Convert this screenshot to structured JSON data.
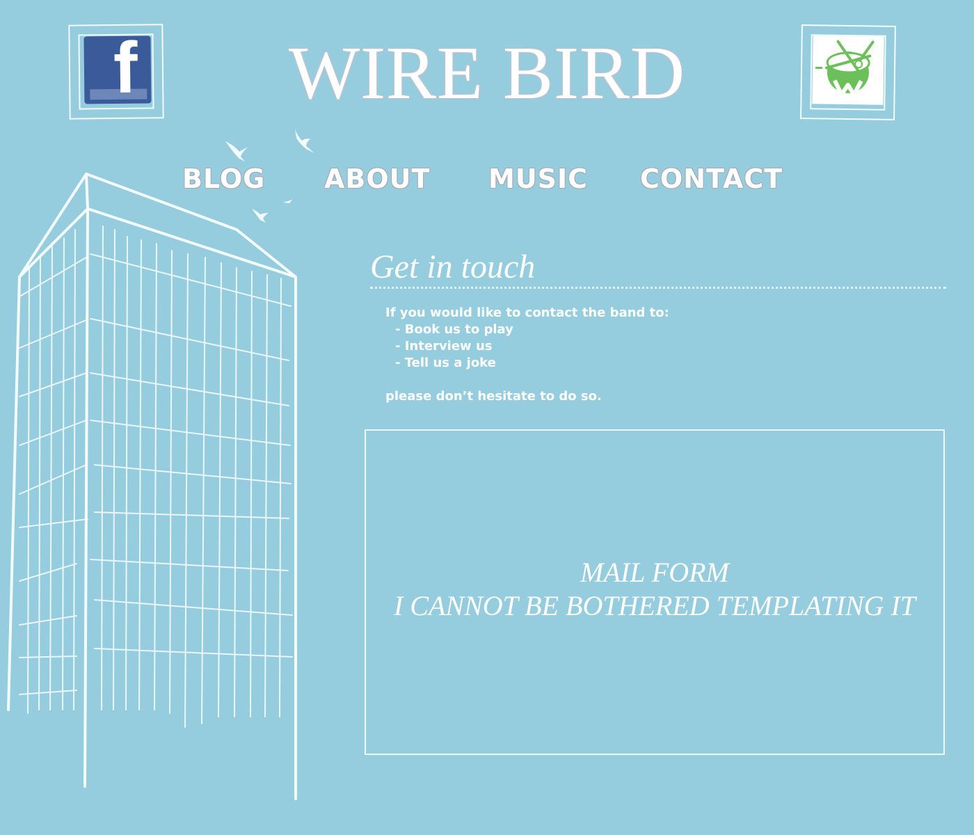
{
  "header": {
    "title": "WIRE BIRD",
    "facebook_icon": "facebook-icon",
    "triplej_icon": "triple-j-unearthed-icon"
  },
  "nav": {
    "items": [
      {
        "label": "BLOG"
      },
      {
        "label": "ABOUT"
      },
      {
        "label": "MUSIC"
      },
      {
        "label": "CONTACT"
      }
    ]
  },
  "contact": {
    "heading": "Get in touch",
    "intro": "If you would like to contact the band to:",
    "bullets": [
      "- Book us to play",
      "- Interview us",
      "- Tell us a joke"
    ],
    "outro": "please don’t hesitate to do so."
  },
  "mail_form": {
    "line1": "MAIL FORM",
    "line2": "I CANNOT BE BOTHERED TEMPLATING IT"
  },
  "colors": {
    "background": "#95cddf",
    "text": "#ffffff",
    "facebook_blue": "#3b5a99",
    "drum_green": "#6cc05a"
  }
}
